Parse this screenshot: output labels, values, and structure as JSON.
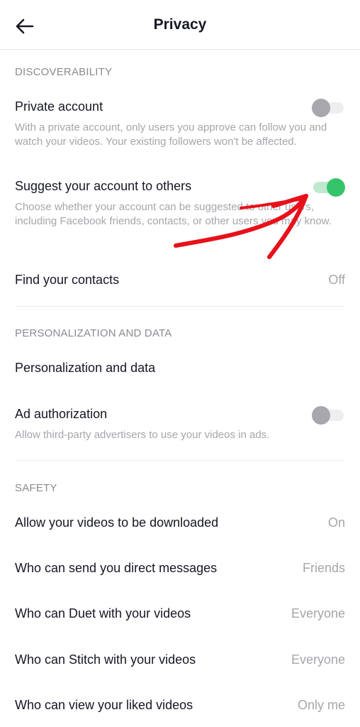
{
  "header": {
    "title": "Privacy",
    "back_icon": "arrow-left-icon"
  },
  "discoverability": {
    "section_title": "DISCOVERABILITY",
    "private_account": {
      "label": "Private account",
      "description": "With a private account, only users you approve can follow you and watch your videos. Your existing followers won't be affected.",
      "toggle_on": false
    },
    "suggest_account": {
      "label": "Suggest your account to others",
      "description": "Choose whether your account can be suggested to other users, including Facebook friends, contacts, or other users you may know.",
      "toggle_on": true
    },
    "find_contacts": {
      "label": "Find your contacts",
      "value": "Off"
    }
  },
  "personalization": {
    "section_title": "PERSONALIZATION AND DATA",
    "personalization_data": {
      "label": "Personalization and data"
    },
    "ad_authorization": {
      "label": "Ad authorization",
      "description": "Allow third-party advertisers to use your videos in ads.",
      "toggle_on": false
    }
  },
  "safety": {
    "section_title": "SAFETY",
    "items": [
      {
        "label": "Allow your videos to be downloaded",
        "value": "On"
      },
      {
        "label": "Who can send you direct messages",
        "value": "Friends"
      },
      {
        "label": "Who can Duet with your videos",
        "value": "Everyone"
      },
      {
        "label": "Who can Stitch with your videos",
        "value": "Everyone"
      },
      {
        "label": "Who can view your liked videos",
        "value": "Only me"
      }
    ]
  },
  "colors": {
    "toggle_on": "#35c46a",
    "toggle_off": "#a7a7ad",
    "annotation_arrow": "#e8101a"
  },
  "annotation": {
    "icon": "red-arrow-annotation-icon"
  }
}
